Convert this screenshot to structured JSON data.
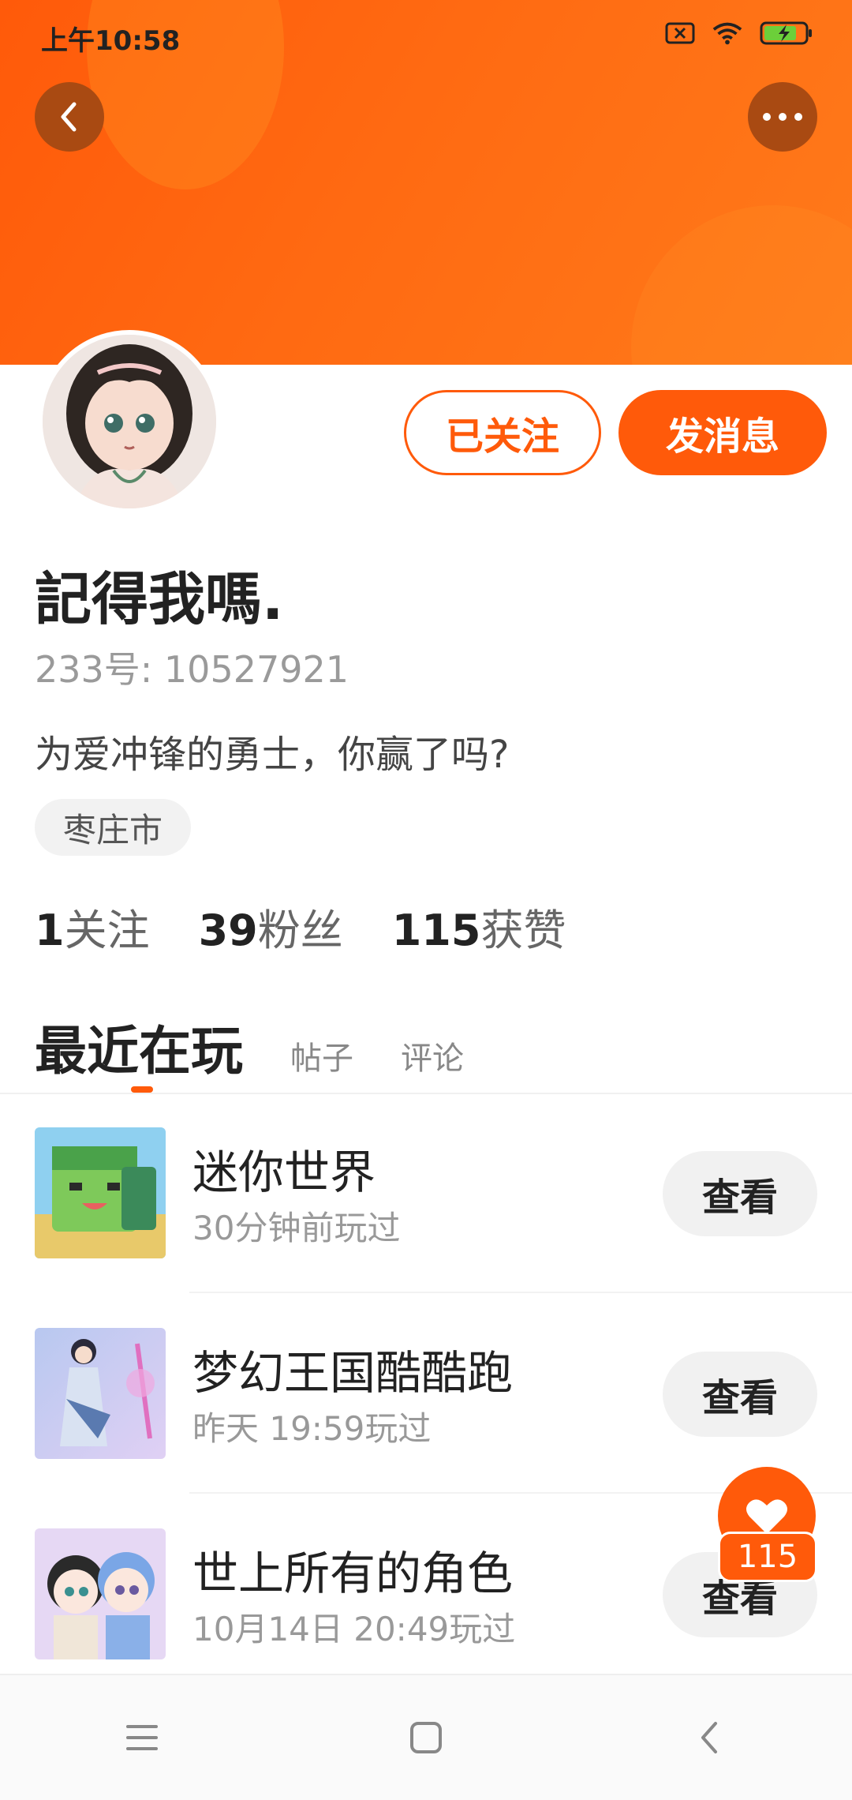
{
  "status_bar": {
    "time": "上午10:58"
  },
  "header": {
    "back_icon": "chevron-left-icon",
    "more_icon": "more-dots-icon"
  },
  "profile": {
    "name": "記得我嗎.",
    "uid_text": "233号: 10527921",
    "bio": "为爱冲锋的勇士，你赢了吗?",
    "location_tag": "枣庄市",
    "follow_button": "已关注",
    "message_button": "发消息",
    "stats": [
      {
        "num": "1",
        "label": "关注"
      },
      {
        "num": "39",
        "label": "粉丝"
      },
      {
        "num": "115",
        "label": "获赞"
      }
    ]
  },
  "tabs": {
    "active": "最近在玩",
    "items": [
      "帖子",
      "评论"
    ]
  },
  "games": [
    {
      "name": "迷你世界",
      "played": "30分钟前玩过",
      "button": "查看"
    },
    {
      "name": "梦幻王国酷酷跑",
      "played": "昨天 19:59玩过",
      "button": "查看"
    },
    {
      "name": "世上所有的角色",
      "played": "10月14日 20:49玩过",
      "button": "查看"
    }
  ],
  "like_fab": {
    "count": "115"
  },
  "colors": {
    "accent": "#ff5a0a",
    "banner": "#ff6a12"
  }
}
